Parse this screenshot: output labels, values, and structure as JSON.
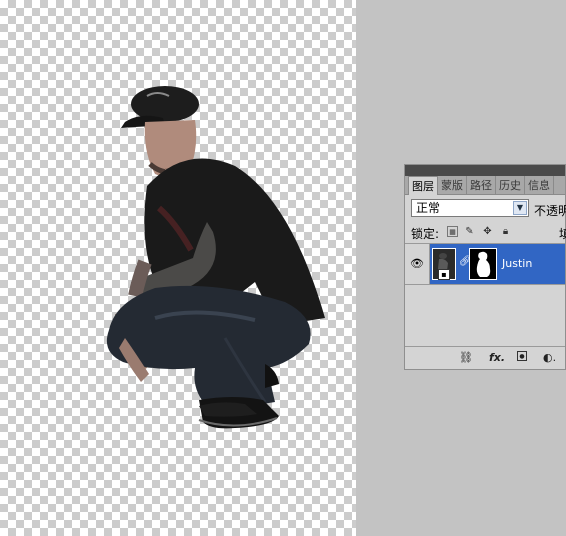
{
  "canvas": {
    "subject": "Person in cap crouching, cut-out on transparent background"
  },
  "layers_panel": {
    "tabs": [
      {
        "label": "图层",
        "active": true
      },
      {
        "label": "蒙版",
        "active": false
      },
      {
        "label": "路径",
        "active": false
      },
      {
        "label": "历史",
        "active": false
      },
      {
        "label": "信息",
        "active": false
      }
    ],
    "blend_mode": "正常",
    "opacity_label": "不透明",
    "lock_label": "锁定:",
    "fill_label": "填",
    "layer": {
      "name": "Justin",
      "visible": true,
      "selected": true
    },
    "icons": {
      "eye": "eye-icon",
      "lock_transparency": "lock-transparent-icon",
      "lock_pixels": "brush-icon",
      "lock_position": "move-icon",
      "lock_all": "lock-icon",
      "link": "link-icon",
      "fx": "fx-icon",
      "add_mask": "add-mask-icon",
      "adjustment": "adjustment-layer-icon"
    },
    "colors": {
      "selection": "#3166c4",
      "panel_bg": "#d4d4d4"
    }
  }
}
